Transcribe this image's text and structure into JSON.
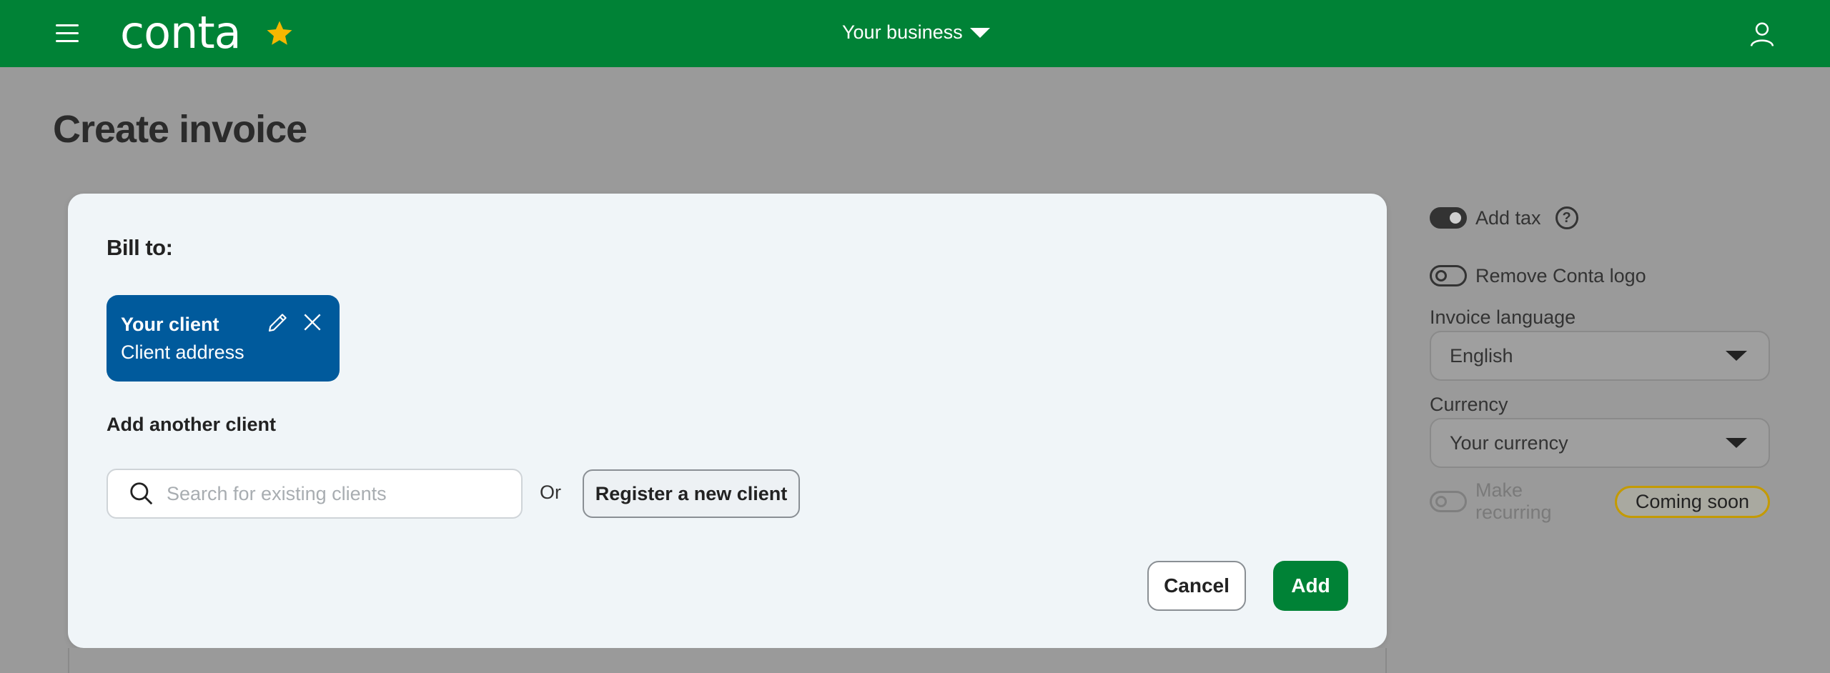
{
  "header": {
    "logo_text": "conta",
    "business_label": "Your business",
    "icons": [
      "menu-icon",
      "star-icon",
      "chevron-down-icon",
      "user-icon"
    ],
    "brand_color": "#008236",
    "star_color": "#f5b700"
  },
  "page": {
    "title": "Create invoice"
  },
  "modal": {
    "bill_to_label": "Bill to:",
    "client": {
      "name": "Your client",
      "address": "Client address",
      "card_color": "#005a9c"
    },
    "add_another_label": "Add another client",
    "search": {
      "placeholder": "Search for existing clients",
      "value": ""
    },
    "or_label": "Or",
    "register_button": "Register a new client",
    "cancel_button": "Cancel",
    "add_button": "Add"
  },
  "settings": {
    "add_tax": {
      "label": "Add tax",
      "on": true
    },
    "remove_logo": {
      "label": "Remove Conta logo",
      "on": false
    },
    "invoice_language": {
      "label": "Invoice language",
      "value": "English"
    },
    "currency": {
      "label": "Currency",
      "value": "Your currency"
    },
    "make_recurring": {
      "label": "Make recurring",
      "on": false,
      "disabled": true,
      "badge": "Coming soon"
    }
  }
}
